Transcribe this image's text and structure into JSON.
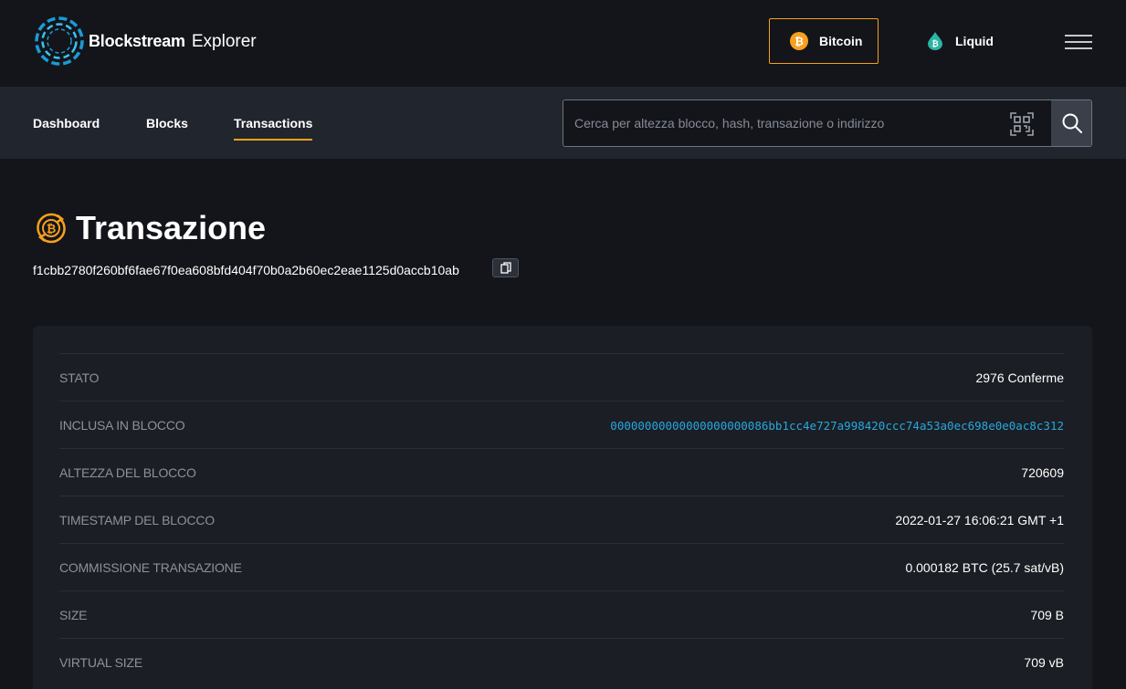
{
  "header": {
    "brand_bold": "Blockstream",
    "brand_light": "Explorer",
    "networks": [
      {
        "label": "Bitcoin",
        "icon": "bitcoin-icon",
        "active": true
      },
      {
        "label": "Liquid",
        "icon": "liquid-icon",
        "active": false
      }
    ],
    "menu_icon": "hamburger-menu-icon"
  },
  "nav": {
    "items": [
      {
        "label": "Dashboard",
        "active": false
      },
      {
        "label": "Blocks",
        "active": false
      },
      {
        "label": "Transactions",
        "active": true
      }
    ]
  },
  "search": {
    "placeholder": "Cerca per altezza blocco, hash, transazione o indirizzo",
    "value": ""
  },
  "transaction": {
    "title": "Transazione",
    "txid": "f1cbb2780f260bf6fae67f0ea608bfd404f70b0a2b60ec2eae1125d0accb10ab",
    "rows": [
      {
        "label": "STATO",
        "value": "2976 Conferme"
      },
      {
        "label": "INCLUSA IN BLOCCO",
        "value": "00000000000000000000086bb1cc4e727a998420ccc74a53a0ec698e0e0ac8c312"
      },
      {
        "label": "ALTEZZA DEL BLOCCO",
        "value": "720609"
      },
      {
        "label": "TIMESTAMP DEL BLOCCO",
        "value": "2022-01-27 16:06:21 GMT +1"
      },
      {
        "label": "COMMISSIONE TRANSAZIONE",
        "value": "0.000182 BTC (25.7 sat/vB)"
      },
      {
        "label": "SIZE",
        "value": "709 B"
      },
      {
        "label": "VIRTUAL SIZE",
        "value": "709 vB"
      }
    ]
  },
  "colors": {
    "accent": "#f7a01e",
    "link": "#27a8e0",
    "liquid": "#2ab5a5",
    "background": "#13151a",
    "navbar": "#21252d",
    "card": "#1b1e24"
  }
}
